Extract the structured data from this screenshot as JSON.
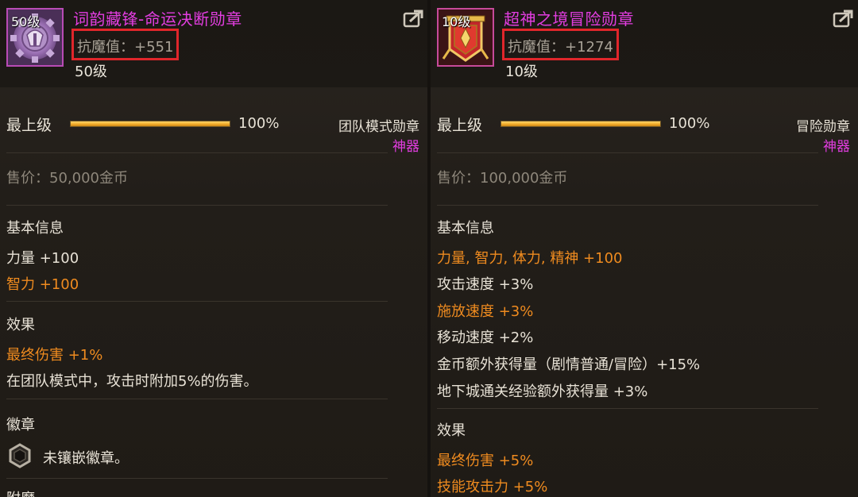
{
  "left": {
    "level_badge": "50级",
    "name": "词韵藏锋-命运决断勋章",
    "resist": "抗魔值：+551",
    "level_text": "50级",
    "grade": "最上级",
    "progress": "100%",
    "progress_fraction": 1.0,
    "category": "团队模式勋章",
    "rarity": "神器",
    "price": "售价：50,000金币",
    "basic_title": "基本信息",
    "stat1": "力量 +100",
    "stat2": "智力 +100",
    "effect_title": "效果",
    "effect1": "最终伤害 +1%",
    "effect2": "在团队模式中，攻击时附加5%的伤害。",
    "emblem_title": "徽章",
    "emblem_text": "未镶嵌徽章。",
    "cutoff_title": "附魔"
  },
  "right": {
    "level_badge": "10级",
    "name": "超神之境冒险勋章",
    "resist": "抗魔值：+1274",
    "level_text": "10级",
    "grade": "最上级",
    "progress": "100%",
    "progress_fraction": 1.0,
    "category": "冒险勋章",
    "rarity": "神器",
    "price": "售价：100,000金币",
    "basic_title": "基本信息",
    "stat1": "力量, 智力, 体力, 精神 +100",
    "stat2": "攻击速度 +3%",
    "stat3": "施放速度 +3%",
    "stat4": "移动速度 +2%",
    "stat5": "金币额外获得量（剧情普通/冒险）+15%",
    "stat6": "地下城通关经验额外获得量 +3%",
    "effect_title": "效果",
    "effect1": "最终伤害 +5%",
    "effect2": "技能攻击力 +5%"
  },
  "colors": {
    "name": "#e23de0",
    "highlight": "#ef8b1f",
    "resist_box": "#e0262b",
    "bar": "#f2ad2c"
  },
  "icons": {
    "left_item": "gear-medal-icon",
    "right_item": "banner-medal-icon",
    "share": "share-arrow-icon",
    "emblem": "hexagon-socket-icon"
  }
}
